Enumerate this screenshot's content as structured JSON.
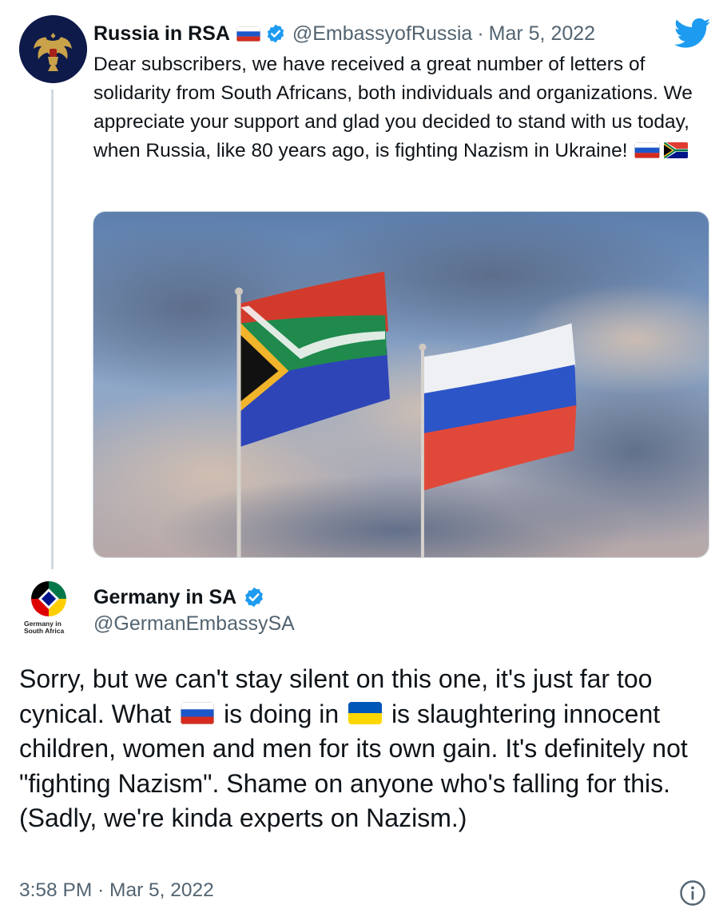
{
  "quoted_tweet": {
    "author_name": "Russia in RSA",
    "name_flag": "russia-flag-icon",
    "verified": true,
    "handle": "@EmbassyofRussia",
    "separator": "·",
    "date": "Mar 5, 2022",
    "text": "Dear subscribers, we have received a great number of letters of solidarity from South Africans, both individuals and organizations. We appreciate your support and glad you decided to stand with us today, when Russia, like 80 years ago, is fighting Nazism in Ukraine!",
    "text_flags": [
      "russia-flag-icon",
      "south-africa-flag-icon"
    ],
    "media_description_icon": "flags-photo"
  },
  "main_tweet": {
    "author_name": "Germany in SA",
    "verified": true,
    "handle": "@GermanEmbassySA",
    "avatar_caption_line1": "Germany in",
    "avatar_caption_line2": "South Africa",
    "text_part1": "Sorry, but we can't stay silent on this one, it's just far too cynical. What",
    "text_flag1": "russia-flag-icon",
    "text_part2": "is doing in",
    "text_flag2": "ukraine-flag-icon",
    "text_part3": "is slaughtering innocent children, women and men for its own gain. It's definitely not \"fighting Nazism\". Shame on anyone who's falling for this. (Sadly, we're kinda experts on Nazism.)",
    "time": "3:58 PM",
    "separator": "·",
    "date": "Mar 5, 2022"
  },
  "colors": {
    "twitter_blue": "#1d9bf0",
    "text_primary": "#0f1419",
    "text_secondary": "#536471",
    "thread_line": "#cfd9de"
  }
}
